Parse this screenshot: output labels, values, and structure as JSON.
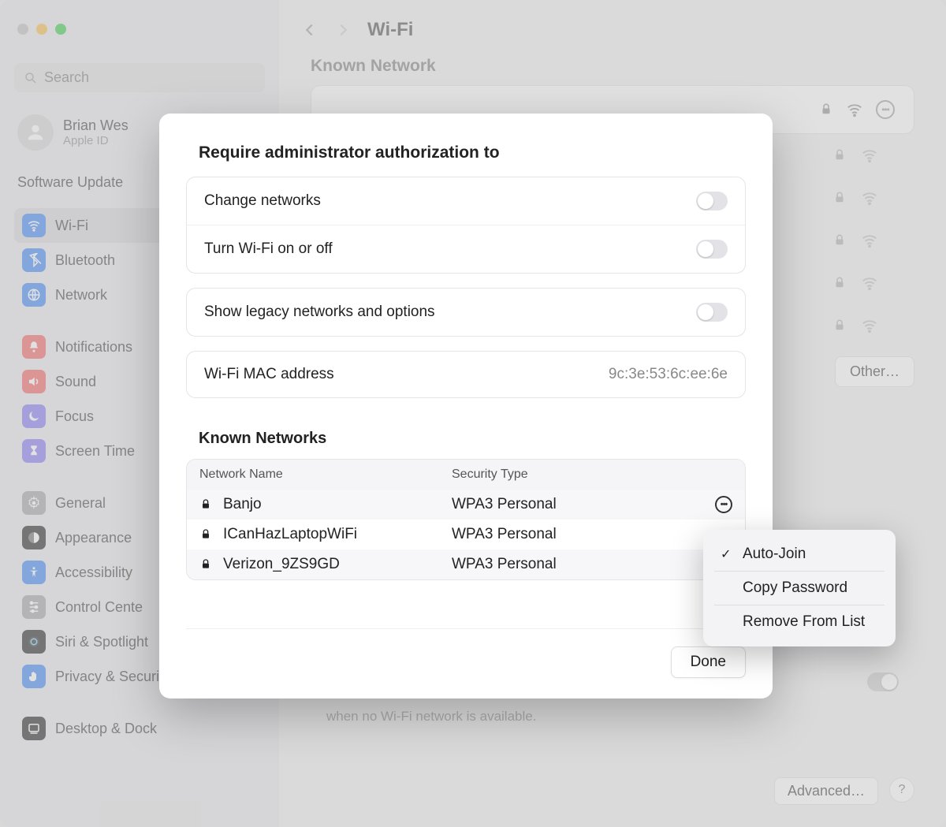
{
  "search": {
    "placeholder": "Search"
  },
  "user": {
    "name": "Brian Wes",
    "sub": "Apple ID"
  },
  "software_update_label": "Software Update",
  "sidebar": {
    "group1": [
      {
        "label": "Wi-Fi",
        "color": "#2f7ef6",
        "icon": "wifi",
        "active": true
      },
      {
        "label": "Bluetooth",
        "color": "#2f7ef6",
        "icon": "bluetooth"
      },
      {
        "label": "Network",
        "color": "#2f7ef6",
        "icon": "globe"
      }
    ],
    "group2": [
      {
        "label": "Notifications",
        "color": "#f15757",
        "icon": "bell"
      },
      {
        "label": "Sound",
        "color": "#f15757",
        "icon": "sound"
      },
      {
        "label": "Focus",
        "color": "#7a6ef1",
        "icon": "moon"
      },
      {
        "label": "Screen Time",
        "color": "#7a6ef1",
        "icon": "hourglass"
      }
    ],
    "group3": [
      {
        "label": "General",
        "color": "#9b9b9f",
        "icon": "gear"
      },
      {
        "label": "Appearance",
        "color": "#111",
        "icon": "appearance"
      },
      {
        "label": "Accessibility",
        "color": "#2f7ef6",
        "icon": "accessibility"
      },
      {
        "label": "Control Cente",
        "color": "#9b9b9f",
        "icon": "sliders"
      },
      {
        "label": "Siri & Spotlight",
        "color": "#111",
        "icon": "siri"
      },
      {
        "label": "Privacy & Security",
        "color": "#2f7ef6",
        "icon": "hand"
      }
    ],
    "group4": [
      {
        "label": "Desktop & Dock",
        "color": "#111",
        "icon": "dock"
      }
    ]
  },
  "header": {
    "title": "Wi-Fi"
  },
  "bg": {
    "known_label": "Known Network",
    "other_btn": "Other…",
    "advanced_btn": "Advanced…",
    "hotspot_text": "when no Wi-Fi network is available."
  },
  "modal": {
    "title": "Require administrator authorization to",
    "opts": {
      "change": "Change networks",
      "onoff": "Turn Wi-Fi on or off",
      "legacy": "Show legacy networks and options"
    },
    "mac_label": "Wi-Fi MAC address",
    "mac_value": "9c:3e:53:6c:ee:6e",
    "known_label": "Known Networks",
    "cols": {
      "name": "Network Name",
      "sec": "Security Type"
    },
    "rows": [
      {
        "name": "Banjo",
        "sec": "WPA3 Personal",
        "more": true
      },
      {
        "name": "ICanHazLaptopWiFi",
        "sec": "WPA3 Personal"
      },
      {
        "name": "Verizon_9ZS9GD",
        "sec": "WPA3 Personal"
      }
    ],
    "done": "Done"
  },
  "ctx": {
    "auto": "Auto-Join",
    "copy": "Copy Password",
    "remove": "Remove From List"
  }
}
